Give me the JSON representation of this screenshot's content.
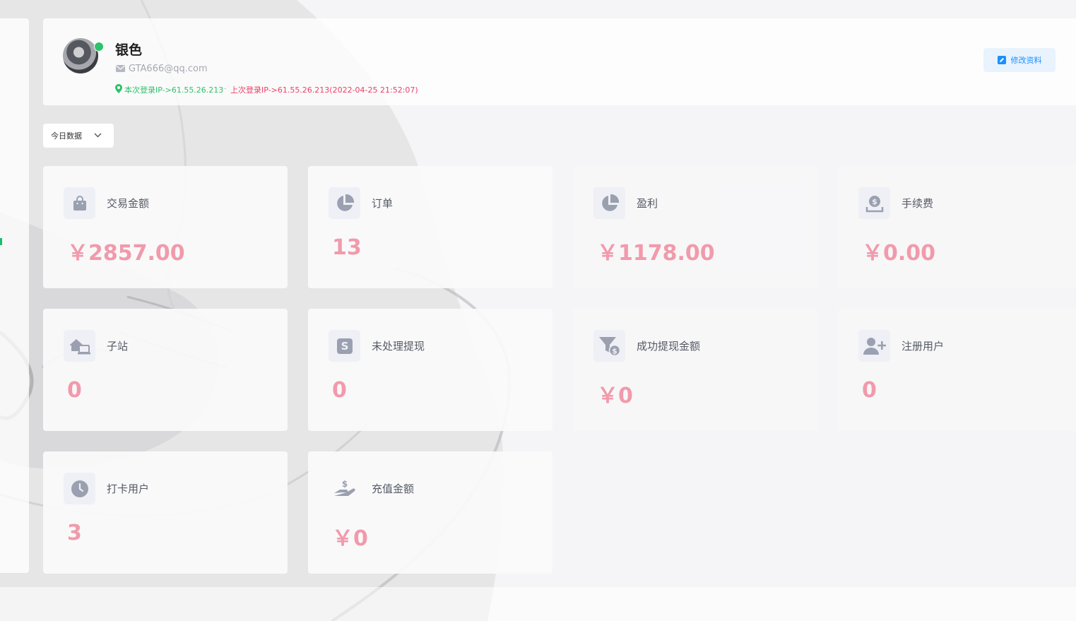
{
  "profile": {
    "name": "银色",
    "email": "GTA666@qq.com",
    "login_current": "本次登录IP->61.55.26.213",
    "login_separator": "·",
    "login_last": "上次登录IP->61.55.26.213(2022-04-25 21:52:07)",
    "edit_label": "修改资料",
    "online": true
  },
  "filter": {
    "period": "今日数据"
  },
  "stats": [
    {
      "label": "交易金额",
      "value": "￥2857.00",
      "icon": "shopping-bag-icon"
    },
    {
      "label": "订单",
      "value": "13",
      "icon": "pie-chart-icon"
    },
    {
      "label": "盈利",
      "value": "￥1178.00",
      "icon": "pie-chart-icon"
    },
    {
      "label": "手续费",
      "value": "￥0.00",
      "icon": "money-tray-icon"
    },
    {
      "label": "子站",
      "value": "0",
      "icon": "home-network-icon"
    },
    {
      "label": "未处理提现",
      "value": "0",
      "icon": "dollar-square-icon"
    },
    {
      "label": "成功提现金额",
      "value": "￥0",
      "icon": "funnel-dollar-icon"
    },
    {
      "label": "注册用户",
      "value": "0",
      "icon": "user-plus-icon"
    },
    {
      "label": "打卡用户",
      "value": "3",
      "icon": "clock-icon"
    },
    {
      "label": "充值金额",
      "value": "￥0",
      "icon": "hand-dollar-icon"
    }
  ],
  "colors": {
    "value_pink": "#f19aab",
    "online_green": "#2dc26b",
    "last_login_red": "#ed4066",
    "edit_blue": "#1890ff",
    "icon_gray": "#9aa0b0"
  }
}
